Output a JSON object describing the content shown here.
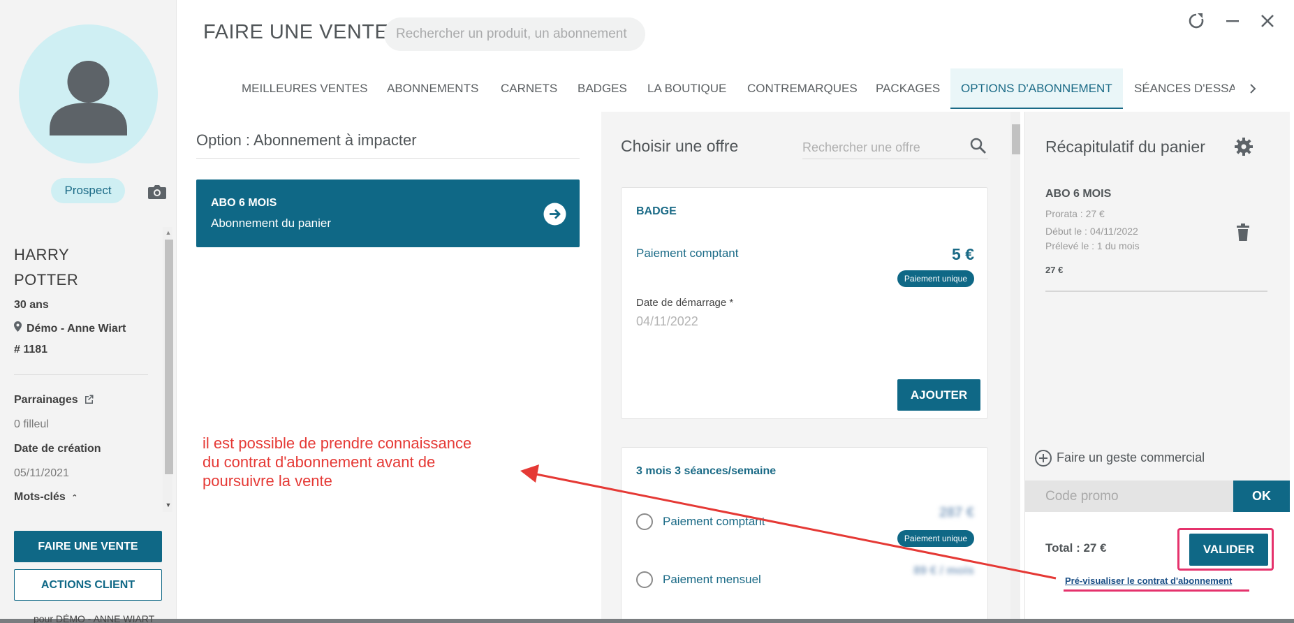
{
  "header": {
    "title": "FAIRE UNE VENTE",
    "search_placeholder": "Rechercher un produit, un abonnement",
    "icons": [
      "refresh-icon",
      "minimize-icon",
      "close-icon"
    ]
  },
  "tabs": [
    {
      "label": "MEILLEURES VENTES",
      "active": false
    },
    {
      "label": "ABONNEMENTS",
      "active": false
    },
    {
      "label": "CARNETS",
      "active": false
    },
    {
      "label": "BADGES",
      "active": false
    },
    {
      "label": "LA BOUTIQUE",
      "active": false
    },
    {
      "label": "CONTREMARQUES",
      "active": false
    },
    {
      "label": "PACKAGES",
      "active": false
    },
    {
      "label": "OPTIONS D'ABONNEMENT",
      "active": true
    },
    {
      "label": "SÉANCES D'ESSA",
      "active": false
    }
  ],
  "sidebar": {
    "status": "Prospect",
    "first_name": "HARRY",
    "last_name": "POTTER",
    "age": "30 ans",
    "location": "Démo - Anne Wiart",
    "id": "# 1181",
    "parrainages_label": "Parrainages",
    "filleul": "0 filleul",
    "creation_label": "Date de création",
    "creation_date": "05/11/2021",
    "keywords_label": "Mots-clés",
    "btn_sale": "FAIRE UNE VENTE",
    "btn_actions": "ACTIONS CLIENT",
    "bottom_text": "pour DÉMO - ANNE WIART"
  },
  "option": {
    "title": "Option : Abonnement à impacter",
    "card_title": "ABO 6 MOIS",
    "card_subtitle": "Abonnement du panier"
  },
  "offers": {
    "title": "Choisir une offre",
    "search_placeholder": "Rechercher une offre",
    "badge": {
      "heading": "BADGE",
      "payment_label": "Paiement comptant",
      "price": "5 €",
      "pill": "Paiement unique",
      "date_label": "Date de démarrage *",
      "date_value": "04/11/2022",
      "add_button": "AJOUTER"
    },
    "plan": {
      "heading": "3 mois 3 séances/semaine",
      "option1_label": "Paiement comptant",
      "option1_price": "287 €",
      "option1_pill": "Paiement unique",
      "option2_label": "Paiement mensuel",
      "option2_price": "89 € / mois"
    }
  },
  "cart": {
    "title": "Récapitulatif du panier",
    "item_name": "ABO 6 MOIS",
    "prorata": "Prorata : 27 €",
    "start": "Début le : 04/11/2022",
    "debit": "Prélevé le : 1 du mois",
    "amount": "27 €",
    "geste": "Faire un geste commercial",
    "promo_placeholder": "Code promo",
    "ok": "OK",
    "total": "Total : 27 €",
    "validate": "VALIDER",
    "preview_link": "Pré-visualiser le contrat d'abonnement"
  },
  "annotation": {
    "line1": "il est possible de prendre connaissance",
    "line2": "du contrat d'abonnement avant de",
    "line3": "poursuivre la vente",
    "color": "#e53935"
  },
  "colors": {
    "primary": "#0f6886",
    "accent_highlight": "#e5326c",
    "avatar_bg": "#cfeff3"
  }
}
